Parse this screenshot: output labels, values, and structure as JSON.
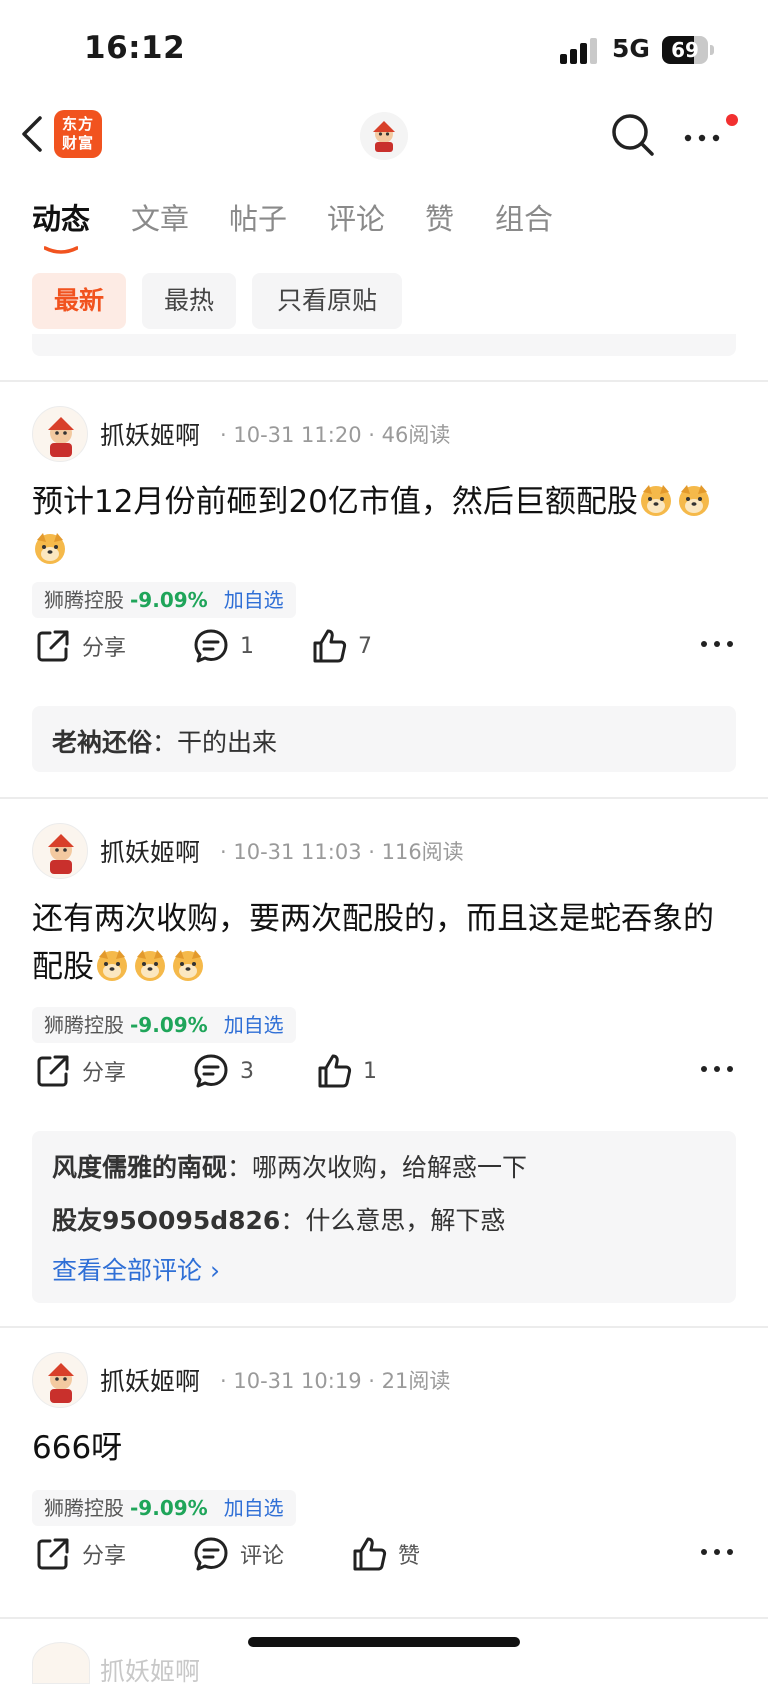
{
  "status_bar": {
    "time": "16:12",
    "network": "5G",
    "battery": "69",
    "battery_level": 0.69
  },
  "header": {
    "logo_text_line1": "东方",
    "logo_text_line2": "财富"
  },
  "tabs": [
    {
      "label": "动态",
      "active": true
    },
    {
      "label": "文章",
      "active": false
    },
    {
      "label": "帖子",
      "active": false
    },
    {
      "label": "评论",
      "active": false
    },
    {
      "label": "赞",
      "active": false
    },
    {
      "label": "组合",
      "active": false
    }
  ],
  "filters": [
    {
      "label": "最新",
      "active": true
    },
    {
      "label": "最热",
      "active": false
    },
    {
      "label": "只看原贴",
      "active": false
    }
  ],
  "colors": {
    "accent": "#f1531f",
    "link": "#2f6fd6",
    "down": "#1fa55a"
  },
  "posts": [
    {
      "author": "抓妖姬啊",
      "meta": "· 10-31 11:20 · 46阅读",
      "content": "预计12月份前砸到20亿市值，然后巨额配股",
      "emoji_count": 3,
      "stock": {
        "name": "狮腾控股",
        "change": "-9.09%",
        "add": "加自选"
      },
      "share": "分享",
      "comment_count": "1",
      "like_count": "7",
      "comments": [
        {
          "user": "老衲还俗",
          "sep": "：",
          "text": "干的出来"
        }
      ]
    },
    {
      "author": "抓妖姬啊",
      "meta": "· 10-31 11:03 · 116阅读",
      "content": "还有两次收购，要两次配股的，而且这是蛇吞象的配股",
      "emoji_count": 3,
      "stock": {
        "name": "狮腾控股",
        "change": "-9.09%",
        "add": "加自选"
      },
      "share": "分享",
      "comment_count": "3",
      "like_count": "1",
      "comments": [
        {
          "user": "风度儒雅的南砚",
          "sep": "：",
          "text": "哪两次收购，给解惑一下"
        },
        {
          "user": "股友95O095d826",
          "sep": "：",
          "text": "什么意思，解下惑"
        }
      ],
      "view_all": "查看全部评论 ›"
    },
    {
      "author": "抓妖姬啊",
      "meta": "· 10-31 10:19 · 21阅读",
      "content": "666呀",
      "emoji_count": 0,
      "stock": {
        "name": "狮腾控股",
        "change": "-9.09%",
        "add": "加自选"
      },
      "share": "分享",
      "comment_count": "评论",
      "like_count": "赞",
      "comments": []
    }
  ],
  "next_post_author": "抓妖姬啊"
}
